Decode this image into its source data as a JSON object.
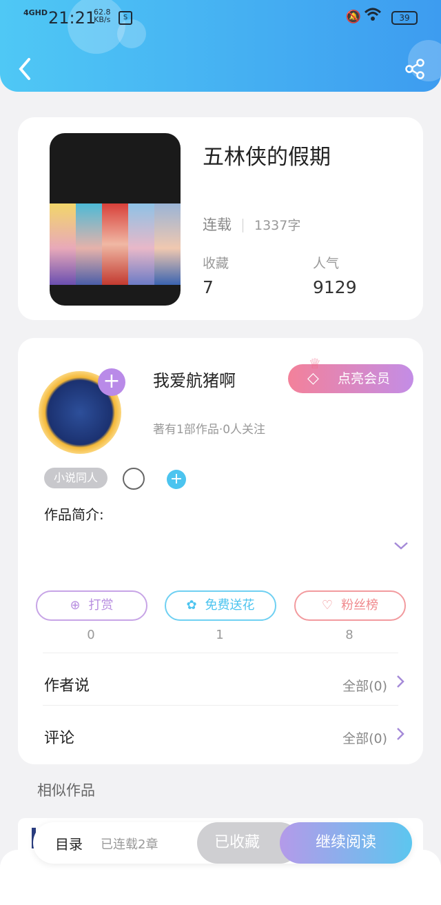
{
  "status_bar": {
    "signal": "4GHD",
    "time": "21:21",
    "speed_value": "62.8",
    "speed_unit": "KB/s",
    "battery": "39",
    "icons": [
      "signal-icon",
      "sim-icon",
      "bell-off-icon",
      "wifi-icon",
      "battery-icon"
    ]
  },
  "nav": {
    "back_icon": "chevron-left-icon",
    "share_icon": "share-icon"
  },
  "book": {
    "title": "五林侠的假期",
    "status": "连载",
    "word_count": "1337字",
    "favorites_label": "收藏",
    "favorites_value": "7",
    "popularity_label": "人气",
    "popularity_value": "9129"
  },
  "author": {
    "name": "我爱航猪啊",
    "vip_button": "点亮会员",
    "meta": "著有1部作品·0人关注",
    "tag": "小说同人",
    "intro_label": "作品简介:"
  },
  "actions": [
    {
      "label": "打赏",
      "count": "0",
      "color": "#b88ee0",
      "icon": "yen-icon"
    },
    {
      "label": "免费送花",
      "count": "1",
      "color": "#4cc4ef",
      "icon": "flower-icon"
    },
    {
      "label": "粉丝榜",
      "count": "8",
      "color": "#f08a8e",
      "icon": "user-heart-icon"
    }
  ],
  "rows": {
    "author_says": {
      "label": "作者说",
      "value": "全部(0)"
    },
    "comments": {
      "label": "评论",
      "value": "全部(0)"
    }
  },
  "similar_label": "相似作品",
  "bottom_bar": {
    "toc": "目录",
    "chapters": "已连载2章",
    "favorited": "已收藏",
    "continue": "继续阅读"
  }
}
